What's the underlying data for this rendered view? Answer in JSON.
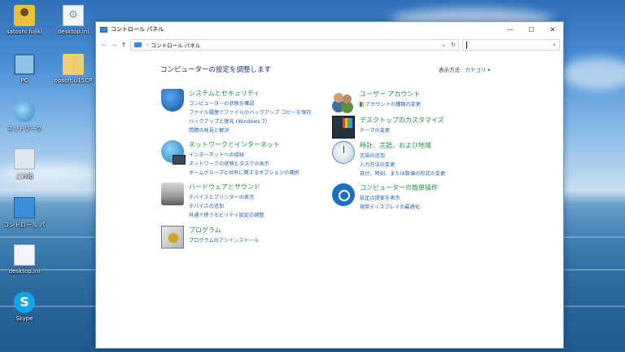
{
  "desktop": {
    "icons": [
      {
        "label": "satoshi.fujiki",
        "icon": "user-folder-icon"
      },
      {
        "label": "desktop.ini",
        "icon": "settings-file-icon"
      },
      {
        "label": "PC",
        "icon": "computer-icon"
      },
      {
        "label": "opsoft.u15CP",
        "icon": "folder-icon"
      },
      {
        "label": "ネットワーク",
        "icon": "network-icon"
      },
      {
        "label": "ごみ箱",
        "icon": "recycle-bin-icon"
      },
      {
        "label": "コントロール パネル",
        "icon": "control-panel-icon"
      },
      {
        "label": "desktop.ini",
        "icon": "file-icon"
      },
      {
        "label": "Skype",
        "icon": "skype-icon"
      }
    ]
  },
  "window": {
    "title": "コントロール パネル",
    "controls": {
      "minimize": "—",
      "maximize": "☐",
      "close": "✕"
    },
    "address": {
      "separator": "›",
      "crumb": "コントロール パネル",
      "dropdown": "⌄",
      "refresh": "↻"
    },
    "search": {
      "placeholder": "",
      "icon": "⌕"
    },
    "header": {
      "title": "コンピューターの設定を調整します",
      "view_by_label": "表示方法:",
      "view_by_value": "カテゴリ ▾"
    },
    "categories": {
      "system": {
        "title": "システムとセキュリティ",
        "links": [
          "コンピューターの状態を確認",
          "ファイル履歴でファイルのバックアップ コピーを保存",
          "バックアップと復元 (Windows 7)",
          "問題の発見と解決"
        ]
      },
      "network": {
        "title": "ネットワークとインターネット",
        "links": [
          "インターネットへの接続",
          "ネットワークの状態とタスクの表示",
          "ホームグループと共有に関するオプションの選択"
        ]
      },
      "hardware": {
        "title": "ハードウェアとサウンド",
        "links": [
          "デバイスとプリンターの表示",
          "デバイスの追加",
          "共通で使うモビリティ設定の調整"
        ]
      },
      "programs": {
        "title": "プログラム",
        "links": [
          "プログラムのアンインストール"
        ]
      },
      "users": {
        "title": "ユーザー アカウント",
        "links": [
          "アカウントの種類の変更"
        ]
      },
      "appearance": {
        "title": "デスクトップのカスタマイズ",
        "links": [
          "テーマの変更"
        ]
      },
      "clock": {
        "title": "時計、言語、および地域",
        "links": [
          "言語の追加",
          "入力方法の変更",
          "日付、時刻、または数値の形式の変更"
        ]
      },
      "access": {
        "title": "コンピューターの簡単操作",
        "links": [
          "設定の提案を表示",
          "視覚ディスプレイの最適化"
        ]
      }
    }
  }
}
